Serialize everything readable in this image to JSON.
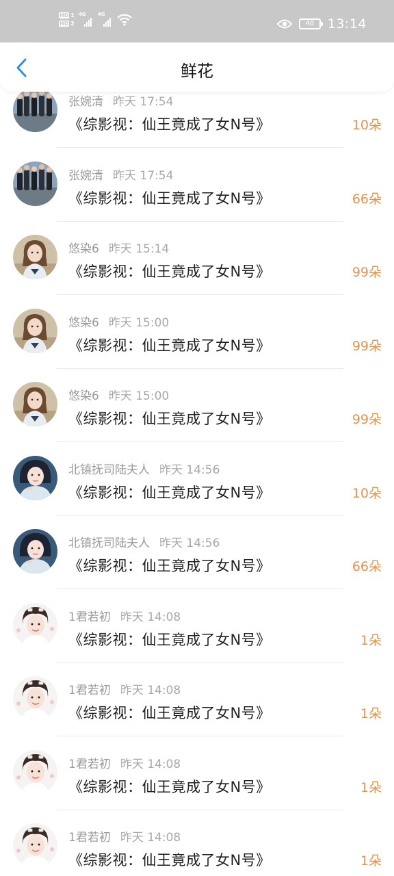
{
  "status_bar": {
    "hd1": "HD",
    "hd1_num": "1",
    "hd2": "HD",
    "hd2_num": "2",
    "net1": "4G",
    "net2": "4G",
    "battery": "48",
    "time": "13:14"
  },
  "nav": {
    "title": "鲜花"
  },
  "colors": {
    "accent": "#2f8fe8",
    "count": "#e8914a",
    "meta": "#9a9a9a"
  },
  "records": [
    {
      "user": "张婉清",
      "time": "昨天 17:54",
      "book": "《综影视：仙王竟成了女N号》",
      "count": "10朵",
      "avatar": "group-photo"
    },
    {
      "user": "张婉清",
      "time": "昨天 17:54",
      "book": "《综影视：仙王竟成了女N号》",
      "count": "66朵",
      "avatar": "group-photo"
    },
    {
      "user": "悠染6",
      "time": "昨天 15:14",
      "book": "《综影视：仙王竟成了女N号》",
      "count": "99朵",
      "avatar": "girl-photo"
    },
    {
      "user": "悠染6",
      "time": "昨天 15:00",
      "book": "《综影视：仙王竟成了女N号》",
      "count": "99朵",
      "avatar": "girl-photo"
    },
    {
      "user": "悠染6",
      "time": "昨天 15:00",
      "book": "《综影视：仙王竟成了女N号》",
      "count": "99朵",
      "avatar": "girl-photo"
    },
    {
      "user": "北镇抚司陆夫人",
      "time": "昨天 14:56",
      "book": "《综影视：仙王竟成了女N号》",
      "count": "10朵",
      "avatar": "costume-photo"
    },
    {
      "user": "北镇抚司陆夫人",
      "time": "昨天 14:56",
      "book": "《综影视：仙王竟成了女N号》",
      "count": "66朵",
      "avatar": "costume-photo"
    },
    {
      "user": "1君若初",
      "time": "昨天 14:08",
      "book": "《综影视：仙王竟成了女N号》",
      "count": "1朵",
      "avatar": "boy-photo"
    },
    {
      "user": "1君若初",
      "time": "昨天 14:08",
      "book": "《综影视：仙王竟成了女N号》",
      "count": "1朵",
      "avatar": "boy-photo"
    },
    {
      "user": "1君若初",
      "time": "昨天 14:08",
      "book": "《综影视：仙王竟成了女N号》",
      "count": "1朵",
      "avatar": "boy-photo"
    },
    {
      "user": "1君若初",
      "time": "昨天 14:08",
      "book": "《综影视：仙王竟成了女N号》",
      "count": "1朵",
      "avatar": "boy-photo"
    }
  ]
}
